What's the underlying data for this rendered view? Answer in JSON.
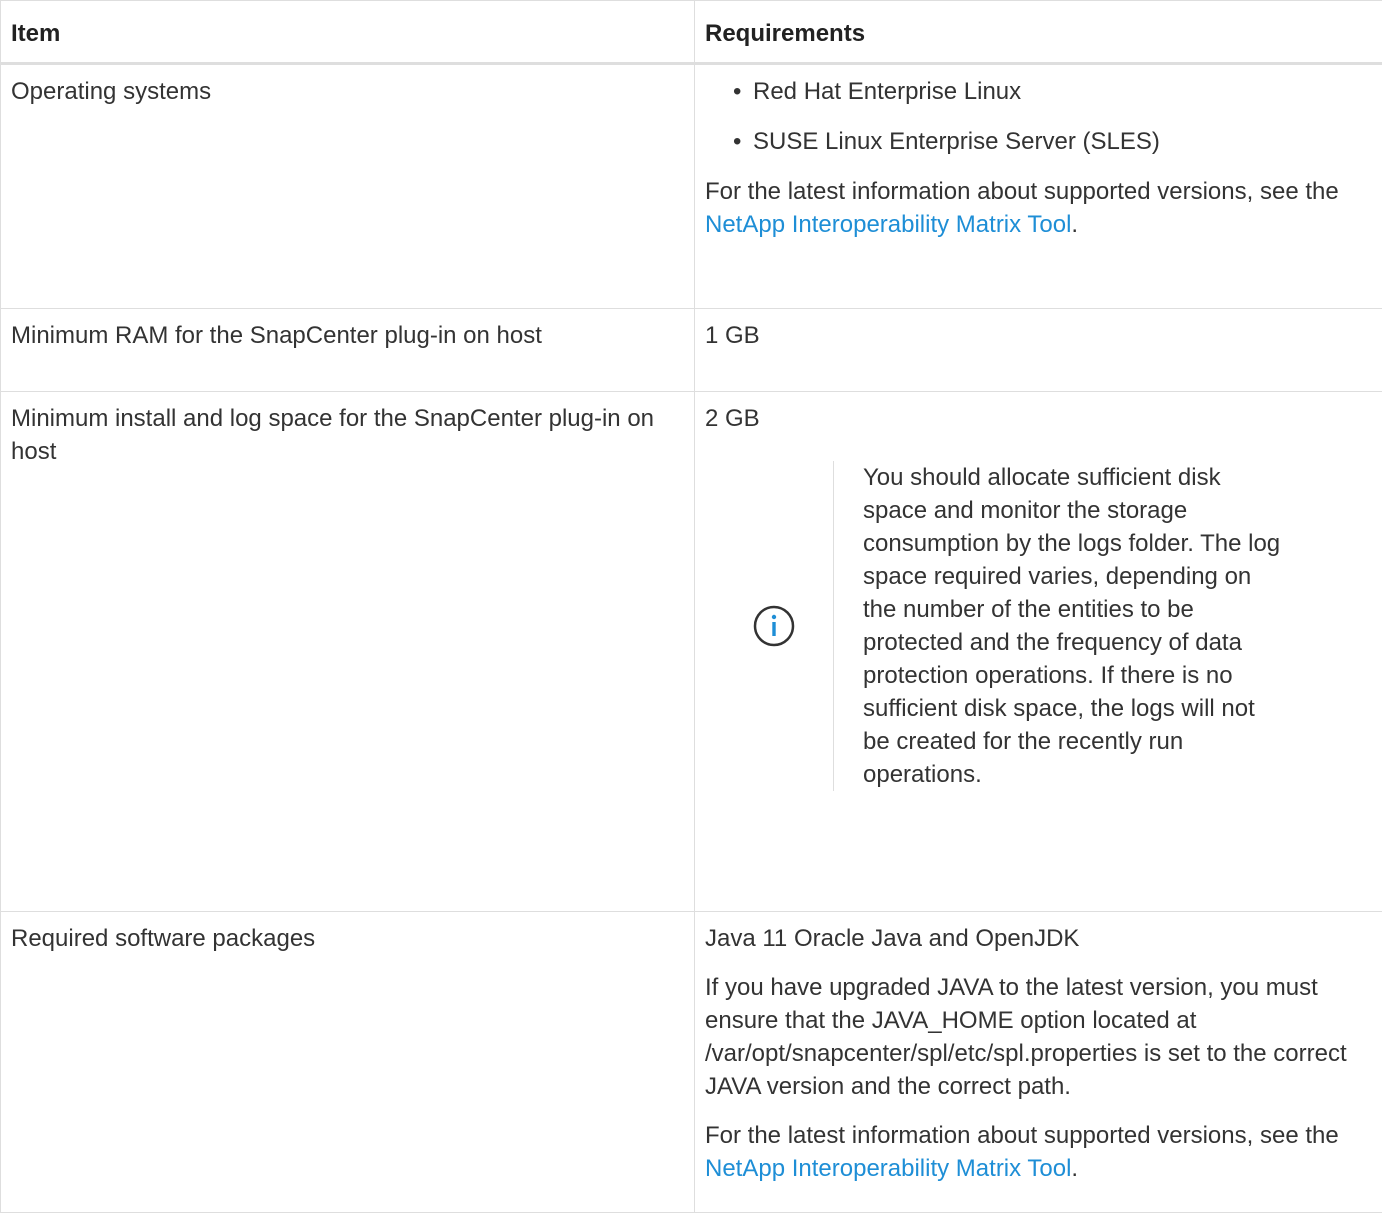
{
  "table": {
    "headers": {
      "item": "Item",
      "requirements": "Requirements"
    },
    "rows": {
      "os": {
        "item": "Operating systems",
        "bullets": [
          "Red Hat Enterprise Linux",
          "SUSE Linux Enterprise Server (SLES)"
        ],
        "info_text": "For the latest information about supported versions, see the ",
        "link_text": "NetApp Interoperability Matrix Tool",
        "link_suffix": "."
      },
      "ram": {
        "item": "Minimum RAM for the SnapCenter plug-in on host",
        "value": "1 GB"
      },
      "install": {
        "item": "Minimum install and log space for the SnapCenter plug-in on host",
        "value": "2 GB",
        "note": "You should allocate sufficient disk space and monitor the storage consumption by the logs folder. The log space required varies, depending on the number of the entities to be protected and the frequency of data protection operations. If there is no sufficient disk space, the logs will not be created for the recently run operations."
      },
      "software": {
        "item": "Required software packages",
        "value": "Java 11 Oracle Java and OpenJDK",
        "upgrade_text": "If you have upgraded JAVA to the latest version, you must ensure that the JAVA_HOME option located at /var/opt/snapcenter/spl/etc/spl.properties is set to the correct JAVA version and the correct path.",
        "info_text": "For the latest information about supported versions, see the ",
        "link_text": "NetApp Interoperability Matrix Tool",
        "link_suffix": "."
      }
    }
  },
  "colors": {
    "text": "#333333",
    "link": "#1e8ed6",
    "border": "#dedede",
    "icon": "#1e8ed6"
  },
  "icons": {
    "note": "info-icon",
    "bullet": "bullet-dot"
  }
}
